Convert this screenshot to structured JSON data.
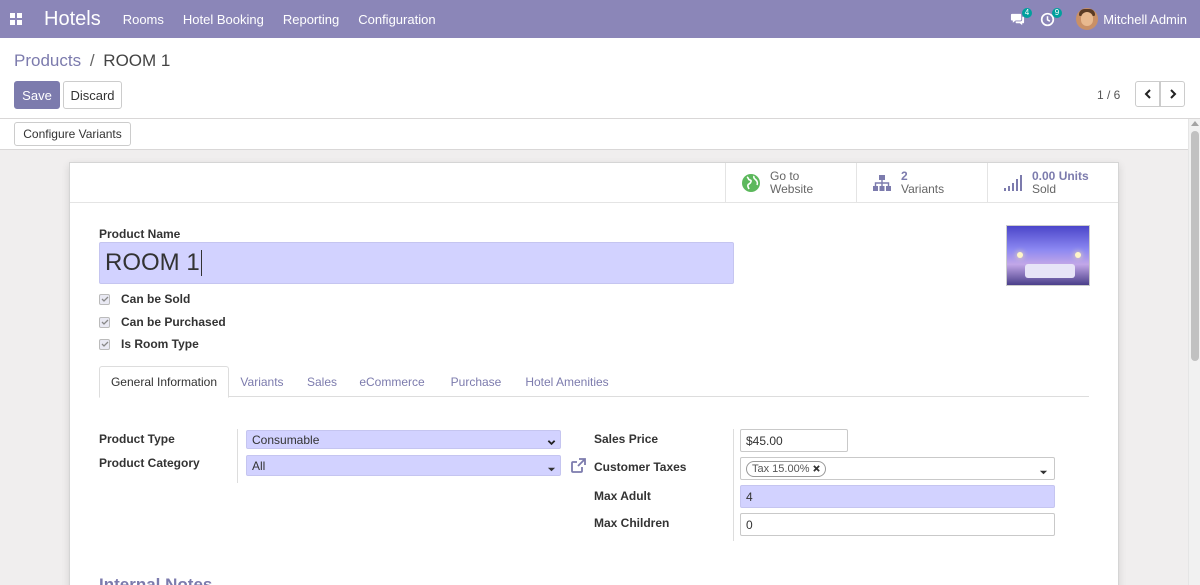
{
  "navbar": {
    "app_name": "Hotels",
    "menu": [
      "Rooms",
      "Hotel Booking",
      "Reporting",
      "Configuration"
    ],
    "messages_count": "4",
    "activities_count": "9",
    "user_name": "Mitchell Admin",
    "color": "#8b86b8"
  },
  "breadcrumb": {
    "parent": "Products",
    "separator": "/",
    "current": "ROOM 1"
  },
  "buttons": {
    "save": "Save",
    "discard": "Discard",
    "configure_variants": "Configure Variants"
  },
  "pager": {
    "text": "1 / 6"
  },
  "stat_buttons": [
    {
      "value": "Go to",
      "label": "Website",
      "icon": "globe-icon"
    },
    {
      "value": "2",
      "label": "Variants",
      "icon": "sitemap-icon"
    },
    {
      "value": "0.00 Units",
      "label": "Sold",
      "icon": "signal-icon"
    }
  ],
  "form": {
    "product_name_label": "Product Name",
    "product_name": "ROOM 1",
    "checkboxes": [
      {
        "label": "Can be Sold",
        "checked": true
      },
      {
        "label": "Can be Purchased",
        "checked": true
      },
      {
        "label": "Is Room Type",
        "checked": true
      }
    ],
    "tabs": [
      "General Information",
      "Variants",
      "Sales",
      "eCommerce",
      "Purchase",
      "Hotel Amenities"
    ],
    "active_tab": "General Information",
    "left_fields": {
      "product_type_label": "Product Type",
      "product_type": "Consumable",
      "product_category_label": "Product Category",
      "product_category": "All"
    },
    "right_fields": {
      "sales_price_label": "Sales Price",
      "sales_price": "$45.00",
      "customer_taxes_label": "Customer Taxes",
      "customer_taxes_tag": "Tax 15.00%",
      "max_adult_label": "Max Adult",
      "max_adult": "4",
      "max_children_label": "Max Children",
      "max_children": "0"
    },
    "internal_notes_heading": "Internal Notes"
  },
  "colors": {
    "accent": "#7c7bad",
    "required_field": "#d2d2ff",
    "globe_green": "#5cb85c"
  }
}
